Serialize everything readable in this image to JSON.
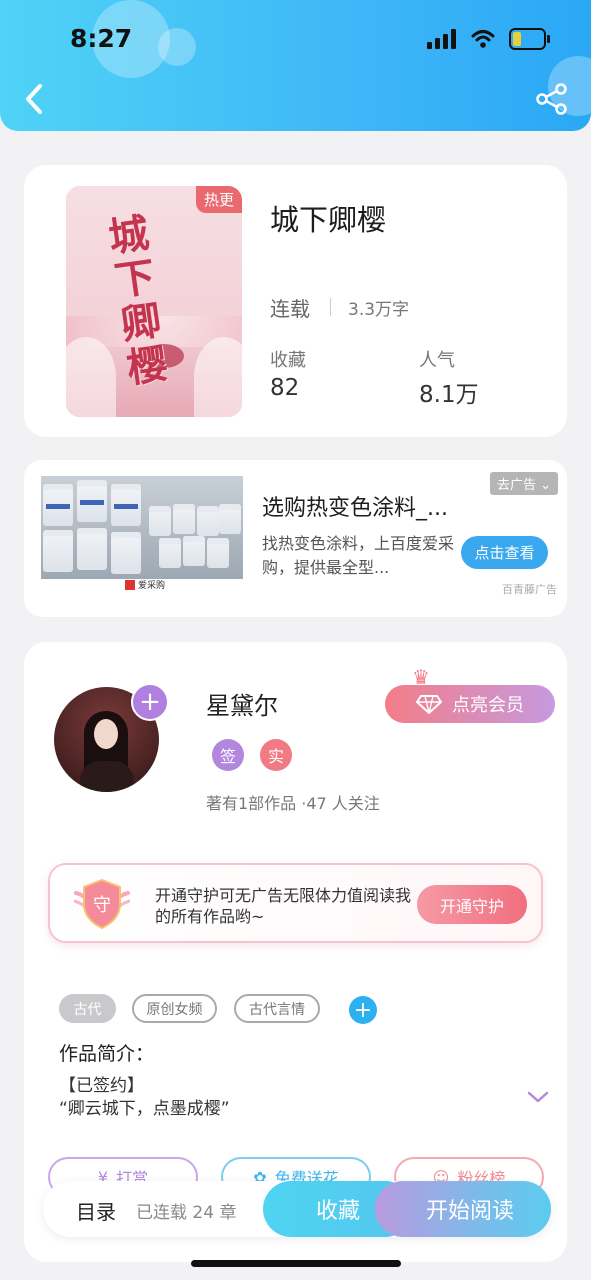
{
  "status_bar": {
    "time": "8:27"
  },
  "book": {
    "hot_badge": "热更",
    "cover_title": "城下卿樱",
    "title": "城下卿樱",
    "status": "连载",
    "word_count": "3.3万字",
    "favorites_label": "收藏",
    "favorites_value": "82",
    "popularity_label": "人气",
    "popularity_value": "8.1万"
  },
  "ad": {
    "title": "选购热变色涂料_...",
    "description": "找热变色涂料，上百度爱采购，提供最全型...",
    "badge": "去广告",
    "cta": "点击查看",
    "source": "百青藤广告",
    "image_logo": "爱采购"
  },
  "author": {
    "name": "星黛尔",
    "vip_button": "点亮会员",
    "tags": [
      {
        "label": "签",
        "color": "#b387de"
      },
      {
        "label": "实",
        "color": "#f27a85"
      }
    ],
    "meta": "著有1部作品 ·47 人关注"
  },
  "guard": {
    "icon_text": "守",
    "text": "开通守护可无广告无限体力值阅读我的所有作品哟~",
    "button": "开通守护"
  },
  "genres": [
    "古代",
    "原创女频",
    "古代言情"
  ],
  "intro": {
    "title": "作品简介：",
    "line1": "【已签约】",
    "line2": "“卿云城下，点墨成樱”"
  },
  "actions": [
    {
      "label": "打赏",
      "color": "#b387de"
    },
    {
      "label": "免费送花",
      "color": "#3fb7ee"
    },
    {
      "label": "粉丝榜",
      "color": "#f08a94"
    }
  ],
  "bottom_bar": {
    "toc": "目录",
    "chapters": "已连载 24 章",
    "favorite": "收藏",
    "read": "开始阅读"
  }
}
